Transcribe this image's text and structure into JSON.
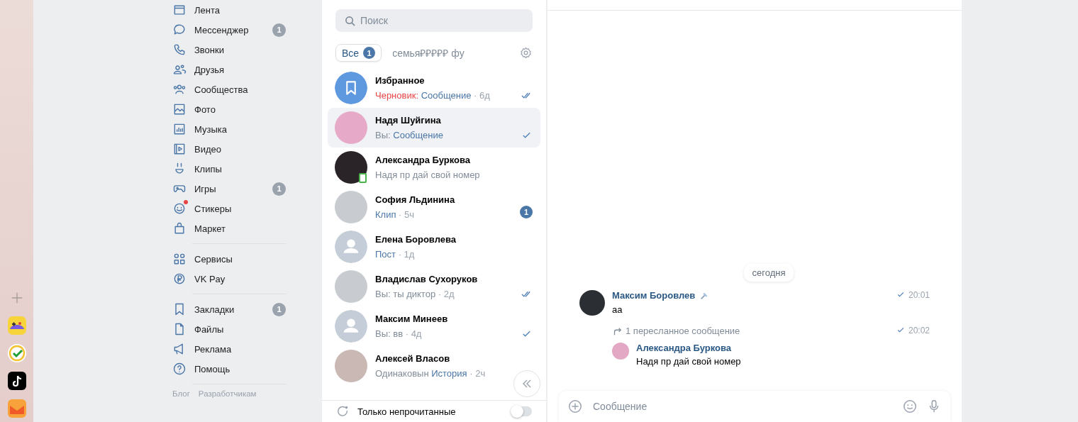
{
  "sidebar": {
    "groups": [
      {
        "items": [
          {
            "label": "Лента"
          },
          {
            "label": "Мессенджер",
            "badge": "1"
          },
          {
            "label": "Звонки"
          },
          {
            "label": "Друзья"
          },
          {
            "label": "Сообщества"
          },
          {
            "label": "Фото"
          },
          {
            "label": "Музыка"
          },
          {
            "label": "Видео"
          },
          {
            "label": "Клипы"
          },
          {
            "label": "Игры",
            "badge": "1"
          },
          {
            "label": "Стикеры",
            "dot": true
          },
          {
            "label": "Маркет"
          }
        ]
      },
      {
        "items": [
          {
            "label": "Сервисы"
          },
          {
            "label": "VK Pay"
          }
        ]
      },
      {
        "items": [
          {
            "label": "Закладки",
            "badge": "1"
          },
          {
            "label": "Файлы"
          },
          {
            "label": "Реклама"
          },
          {
            "label": "Помощь"
          }
        ]
      }
    ],
    "footer_links": [
      "Блог",
      "Разработчикам"
    ]
  },
  "chat_list": {
    "search": {
      "placeholder": "Поиск"
    },
    "folders": [
      {
        "label": "Все",
        "badge": "1",
        "selected": true
      },
      {
        "label": "семья₽₽₽₽₽ фу",
        "selected": false
      }
    ],
    "chats": [
      {
        "name": "Избранное",
        "avatar": {
          "kind": "bookmark"
        },
        "prefix": {
          "kind": "draft",
          "text": "Черновик:"
        },
        "preview": {
          "kind": "link",
          "text": "Сообщение"
        },
        "time": "· 6д",
        "status": {
          "kind": "read"
        },
        "selected": false,
        "online": false
      },
      {
        "name": "Надя Шуйгина",
        "avatar": {
          "kind": "photo"
        },
        "prefix": {
          "kind": "you",
          "text": "Вы:"
        },
        "preview": {
          "kind": "link",
          "text": "Сообщение"
        },
        "status": {
          "kind": "sent"
        },
        "selected": true,
        "online": false
      },
      {
        "name": "Александра Буркова",
        "avatar": {
          "kind": "photo"
        },
        "preview": {
          "kind": "plain",
          "text": "Надя пр дай свой номер"
        },
        "selected": false,
        "online": true
      },
      {
        "name": "София Льдинина",
        "avatar": {
          "kind": "photo"
        },
        "preview": {
          "kind": "link",
          "text": "Клип"
        },
        "time": "· 5ч",
        "status": {
          "kind": "unread",
          "count": "1"
        },
        "selected": false,
        "online": false
      },
      {
        "name": "Елена Боровлева",
        "avatar": {
          "kind": "placeholder"
        },
        "preview": {
          "kind": "link",
          "text": "Пост"
        },
        "time": "· 1д",
        "selected": false,
        "online": false
      },
      {
        "name": "Владислав Сухоруков",
        "avatar": {
          "kind": "photo"
        },
        "prefix": {
          "kind": "you",
          "text": "Вы:"
        },
        "preview": {
          "kind": "plain",
          "text": "ты диктор"
        },
        "time": "· 2д",
        "status": {
          "kind": "read"
        },
        "selected": false,
        "online": false
      },
      {
        "name": "Максим Минеев",
        "avatar": {
          "kind": "placeholder"
        },
        "prefix": {
          "kind": "you",
          "text": "Вы:"
        },
        "preview": {
          "kind": "plain",
          "text": "вв"
        },
        "time": "· 4д",
        "status": {
          "kind": "sent"
        },
        "selected": false,
        "online": false
      },
      {
        "name": "Алексей Власов",
        "avatar": {
          "kind": "photo"
        },
        "prefix": {
          "kind": "you",
          "text": "Одинаковын"
        },
        "preview": {
          "kind": "link",
          "text": "История"
        },
        "time": "· 2ч",
        "selected": false,
        "online": false
      }
    ],
    "unread_only": {
      "label": "Только непрочитанные",
      "on": false
    }
  },
  "conversation": {
    "date": "сегодня",
    "messages": [
      {
        "kind": "text",
        "author": "Максим Боровлев",
        "text": "аа",
        "time": "20:01",
        "sent": true
      },
      {
        "kind": "forward",
        "forward_label": "1 пересланное сообщение",
        "time": "20:02",
        "sent": true,
        "forwarded_author": "Александра Буркова",
        "forwarded_text": "Надя пр дай свой номер"
      }
    ],
    "composer": {
      "placeholder": "Сообщение"
    }
  }
}
